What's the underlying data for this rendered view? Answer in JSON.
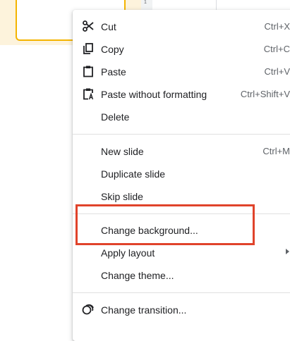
{
  "ruler": {
    "number": "1"
  },
  "menu": {
    "items": [
      {
        "label": "Cut",
        "shortcut": "Ctrl+X",
        "icon": "scissors-icon"
      },
      {
        "label": "Copy",
        "shortcut": "Ctrl+C",
        "icon": "copy-icon"
      },
      {
        "label": "Paste",
        "shortcut": "Ctrl+V",
        "icon": "clipboard-icon"
      },
      {
        "label": "Paste without formatting",
        "shortcut": "Ctrl+Shift+V",
        "icon": "paste-plain-icon"
      },
      {
        "label": "Delete",
        "shortcut": ""
      },
      {
        "label": "New slide",
        "shortcut": "Ctrl+M"
      },
      {
        "label": "Duplicate slide",
        "shortcut": ""
      },
      {
        "label": "Skip slide",
        "shortcut": ""
      },
      {
        "label": "Change background...",
        "shortcut": ""
      },
      {
        "label": "Apply layout",
        "shortcut": "",
        "submenu": true
      },
      {
        "label": "Change theme...",
        "shortcut": ""
      },
      {
        "label": "Change transition...",
        "shortcut": "",
        "icon": "transition-icon"
      }
    ]
  },
  "colors": {
    "highlight": "#e0432b",
    "thumb_border": "#f4b400"
  }
}
